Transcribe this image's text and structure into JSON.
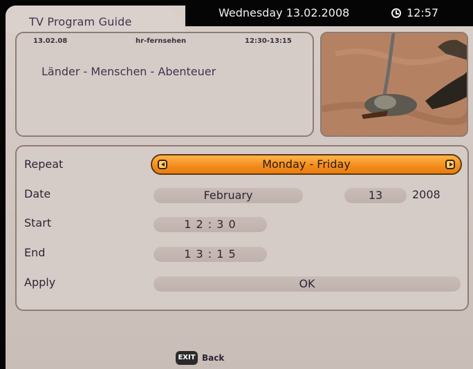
{
  "header": {
    "title": "TV Program Guide",
    "date": "Wednesday 13.02.2008",
    "time": "12:57"
  },
  "program": {
    "date": "13.02.08",
    "channel": "hr-fernsehen",
    "time_range": "12:30-13:15",
    "title": "Länder - Menschen - Abenteuer"
  },
  "form": {
    "repeat_label": "Repeat",
    "repeat_value": "Monday - Friday",
    "date_label": "Date",
    "month": "February",
    "day": "13",
    "year": "2008",
    "start_label": "Start",
    "start_value": "1 2 : 3 0",
    "end_label": "End",
    "end_value": "1 3 : 1 5",
    "apply_label": "Apply",
    "ok_label": "OK"
  },
  "footer": {
    "exit_key": "EXIT",
    "back_label": "Back"
  },
  "colors": {
    "accent_orange": "#f28c1c",
    "panel_bg": "#d6ccc7",
    "border": "#8e7c74"
  }
}
